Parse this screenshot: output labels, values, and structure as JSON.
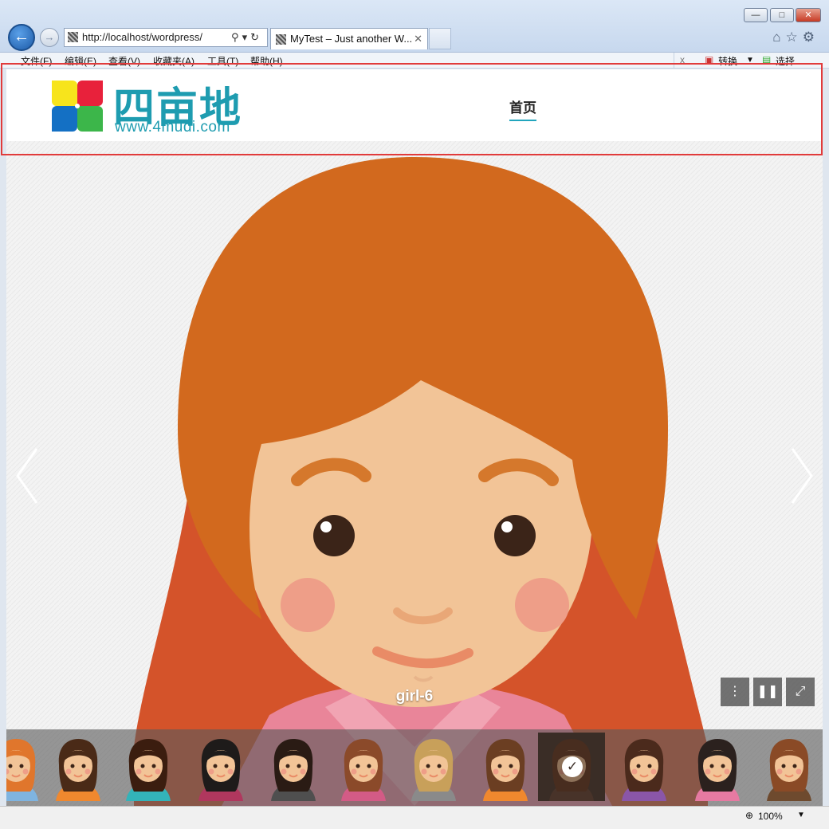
{
  "browser": {
    "address_url": "http://localhost/wordpress/",
    "tab_title": "MyTest – Just another W...",
    "menu": [
      "文件(F)",
      "编辑(E)",
      "查看(V)",
      "收藏夹(A)",
      "工具(T)",
      "帮助(H)"
    ],
    "toolbar_right": [
      "转换",
      "选择"
    ],
    "close_toolbar_label": "x",
    "zoom": "100%"
  },
  "site": {
    "logo_cn": "四亩地",
    "logo_url": "www.4mudi.com",
    "nav_home": "首页"
  },
  "slider": {
    "caption": "girl-6",
    "active_index": 8,
    "thumb_count": 12
  },
  "colors": {
    "brand": "#1e9cb0",
    "nav_underline": "#22a5bd",
    "highlight": "#e13b3b",
    "hair": "#d2691e",
    "skin": "#f2c497"
  }
}
